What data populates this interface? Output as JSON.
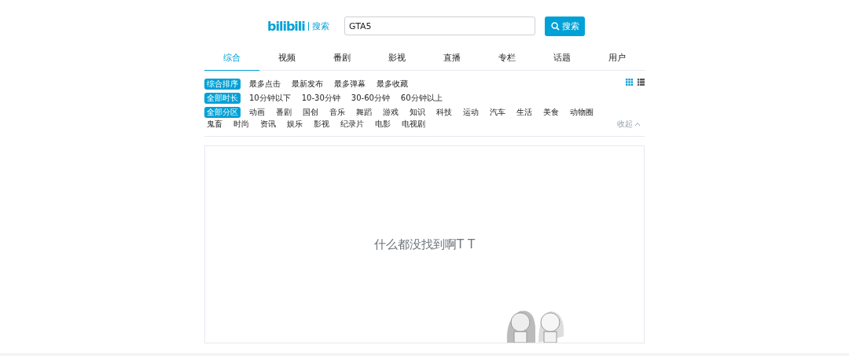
{
  "header": {
    "logo": "bilibili",
    "logo_suffix": "搜索",
    "search": {
      "value": "GTA5"
    },
    "search_button": "搜索"
  },
  "tabs": [
    {
      "label": "综合",
      "selected": true
    },
    {
      "label": "视频",
      "selected": false
    },
    {
      "label": "番剧",
      "selected": false
    },
    {
      "label": "影视",
      "selected": false
    },
    {
      "label": "直播",
      "selected": false
    },
    {
      "label": "专栏",
      "selected": false
    },
    {
      "label": "话题",
      "selected": false
    },
    {
      "label": "用户",
      "selected": false
    }
  ],
  "view_modes": [
    {
      "kind": "grid",
      "selected": true
    },
    {
      "kind": "list",
      "selected": false
    }
  ],
  "filters": [
    {
      "items": [
        {
          "label": "综合排序",
          "selected": true
        },
        {
          "label": "最多点击",
          "selected": false
        },
        {
          "label": "最新发布",
          "selected": false
        },
        {
          "label": "最多弹幕",
          "selected": false
        },
        {
          "label": "最多收藏",
          "selected": false
        }
      ]
    },
    {
      "items": [
        {
          "label": "全部时长",
          "selected": true
        },
        {
          "label": "10分钟以下",
          "selected": false
        },
        {
          "label": "10-30分钟",
          "selected": false
        },
        {
          "label": "30-60分钟",
          "selected": false
        },
        {
          "label": "60分钟以上",
          "selected": false
        }
      ]
    },
    {
      "items": [
        {
          "label": "全部分区",
          "selected": true
        },
        {
          "label": "动画",
          "selected": false
        },
        {
          "label": "番剧",
          "selected": false
        },
        {
          "label": "国创",
          "selected": false
        },
        {
          "label": "音乐",
          "selected": false
        },
        {
          "label": "舞蹈",
          "selected": false
        },
        {
          "label": "游戏",
          "selected": false
        },
        {
          "label": "知识",
          "selected": false
        },
        {
          "label": "科技",
          "selected": false
        },
        {
          "label": "运动",
          "selected": false
        },
        {
          "label": "汽车",
          "selected": false
        },
        {
          "label": "生活",
          "selected": false
        },
        {
          "label": "美食",
          "selected": false
        },
        {
          "label": "动物圈",
          "selected": false
        },
        {
          "label": "鬼畜",
          "selected": false
        },
        {
          "label": "时尚",
          "selected": false
        },
        {
          "label": "资讯",
          "selected": false
        },
        {
          "label": "娱乐",
          "selected": false
        },
        {
          "label": "影视",
          "selected": false
        },
        {
          "label": "纪录片",
          "selected": false
        },
        {
          "label": "电影",
          "selected": false
        },
        {
          "label": "电视剧",
          "selected": false
        }
      ],
      "collapse": "收起"
    }
  ],
  "empty_message": "什么都没找到啊T T"
}
